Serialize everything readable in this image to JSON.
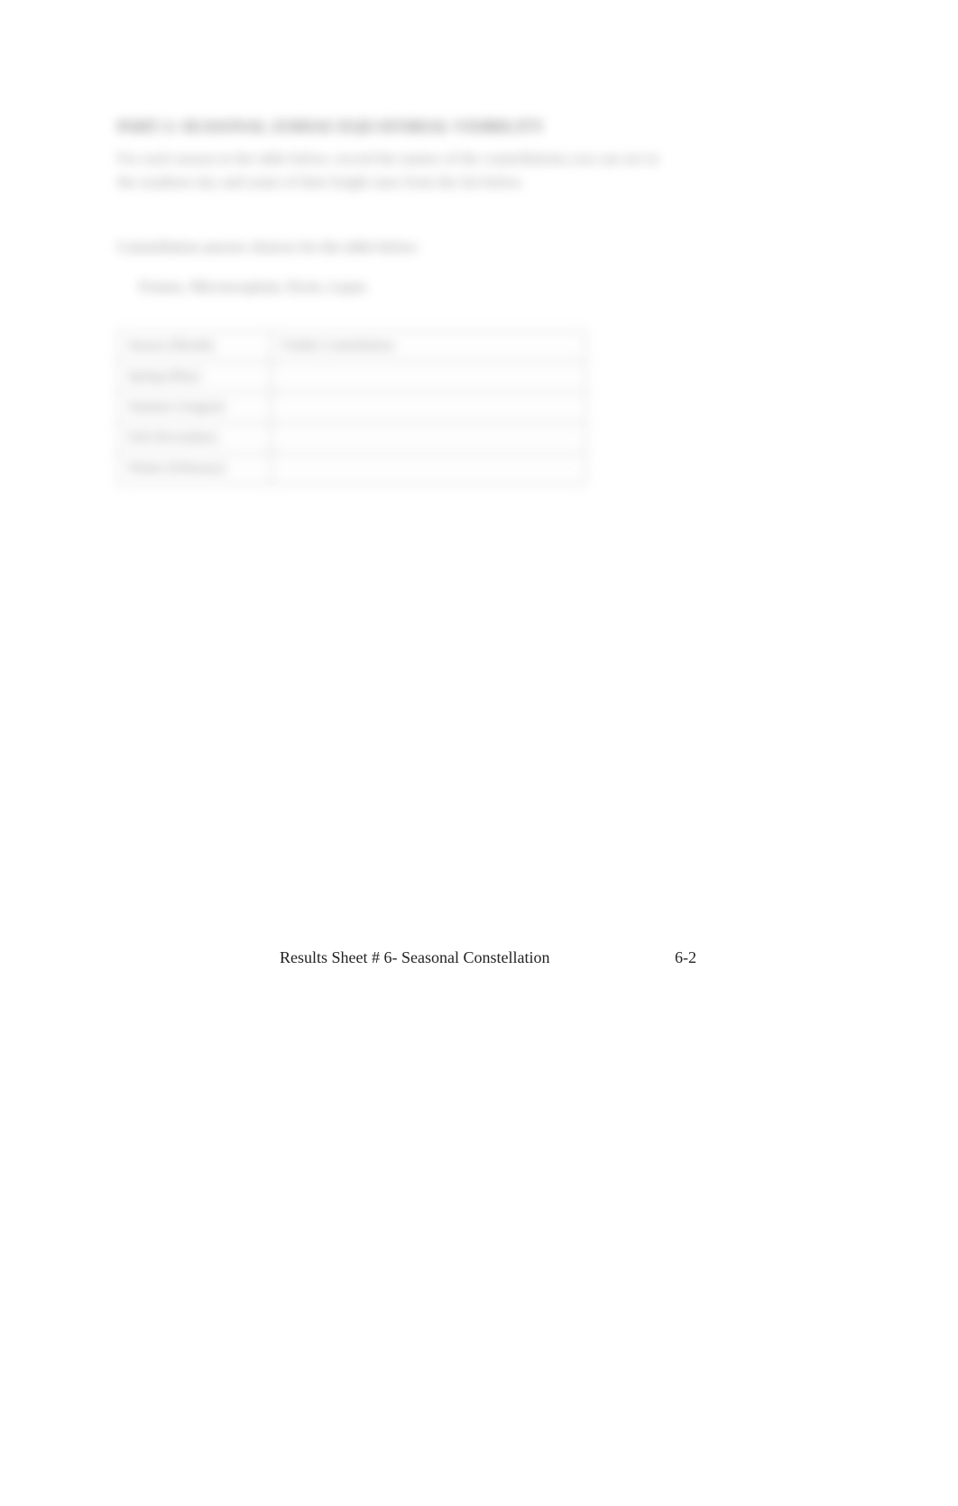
{
  "content": {
    "part_heading": "PART 2: SEASONAL ZODIAC/EQUATORIAL VISIBILITY",
    "instruction": "For each season in the table below, record the names of the constellations you can see in the southern sky and some of their bright stars from the list below.",
    "subheading": "Constellation answer choices for the table below:",
    "choices": "Fornax, Microscopium, Pyxis, Lepus",
    "table": {
      "headers": [
        "Season (Month)",
        "Visible Constellation"
      ],
      "rows": [
        {
          "left": "Spring (May)",
          "right": ""
        },
        {
          "left": "Summer (August)",
          "right": ""
        },
        {
          "left": "Fall (November)",
          "right": ""
        },
        {
          "left": "Winter (February)",
          "right": ""
        }
      ]
    }
  },
  "footer": {
    "title": "Results Sheet # 6- Seasonal Constellation",
    "page": "6-2"
  }
}
